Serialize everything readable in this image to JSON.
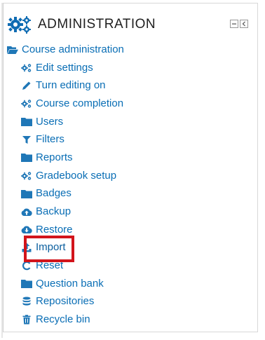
{
  "block": {
    "title": "ADMINISTRATION",
    "controls": [
      {
        "name": "collapse-icon"
      },
      {
        "name": "dock-icon"
      }
    ]
  },
  "tree": {
    "root": {
      "label": "Course administration",
      "icon": "folder-open-icon"
    },
    "items": [
      {
        "label": "Edit settings",
        "icon": "cogs-icon"
      },
      {
        "label": "Turn editing on",
        "icon": "pencil-icon"
      },
      {
        "label": "Course completion",
        "icon": "cogs-icon"
      },
      {
        "label": "Users",
        "icon": "folder-icon"
      },
      {
        "label": "Filters",
        "icon": "filter-icon"
      },
      {
        "label": "Reports",
        "icon": "folder-icon"
      },
      {
        "label": "Gradebook setup",
        "icon": "cogs-icon"
      },
      {
        "label": "Badges",
        "icon": "folder-icon"
      },
      {
        "label": "Backup",
        "icon": "cloud-upload-icon"
      },
      {
        "label": "Restore",
        "icon": "cloud-download-icon"
      },
      {
        "label": "Import",
        "icon": "upload-icon"
      },
      {
        "label": "Reset",
        "icon": "reset-icon"
      },
      {
        "label": "Question bank",
        "icon": "folder-icon"
      },
      {
        "label": "Repositories",
        "icon": "database-icon"
      },
      {
        "label": "Recycle bin",
        "icon": "trash-icon"
      }
    ]
  },
  "colors": {
    "link": "#0a6eb5",
    "icon": "#1f77b7",
    "highlight": "#d2141b",
    "title": "#1f1f1f"
  }
}
